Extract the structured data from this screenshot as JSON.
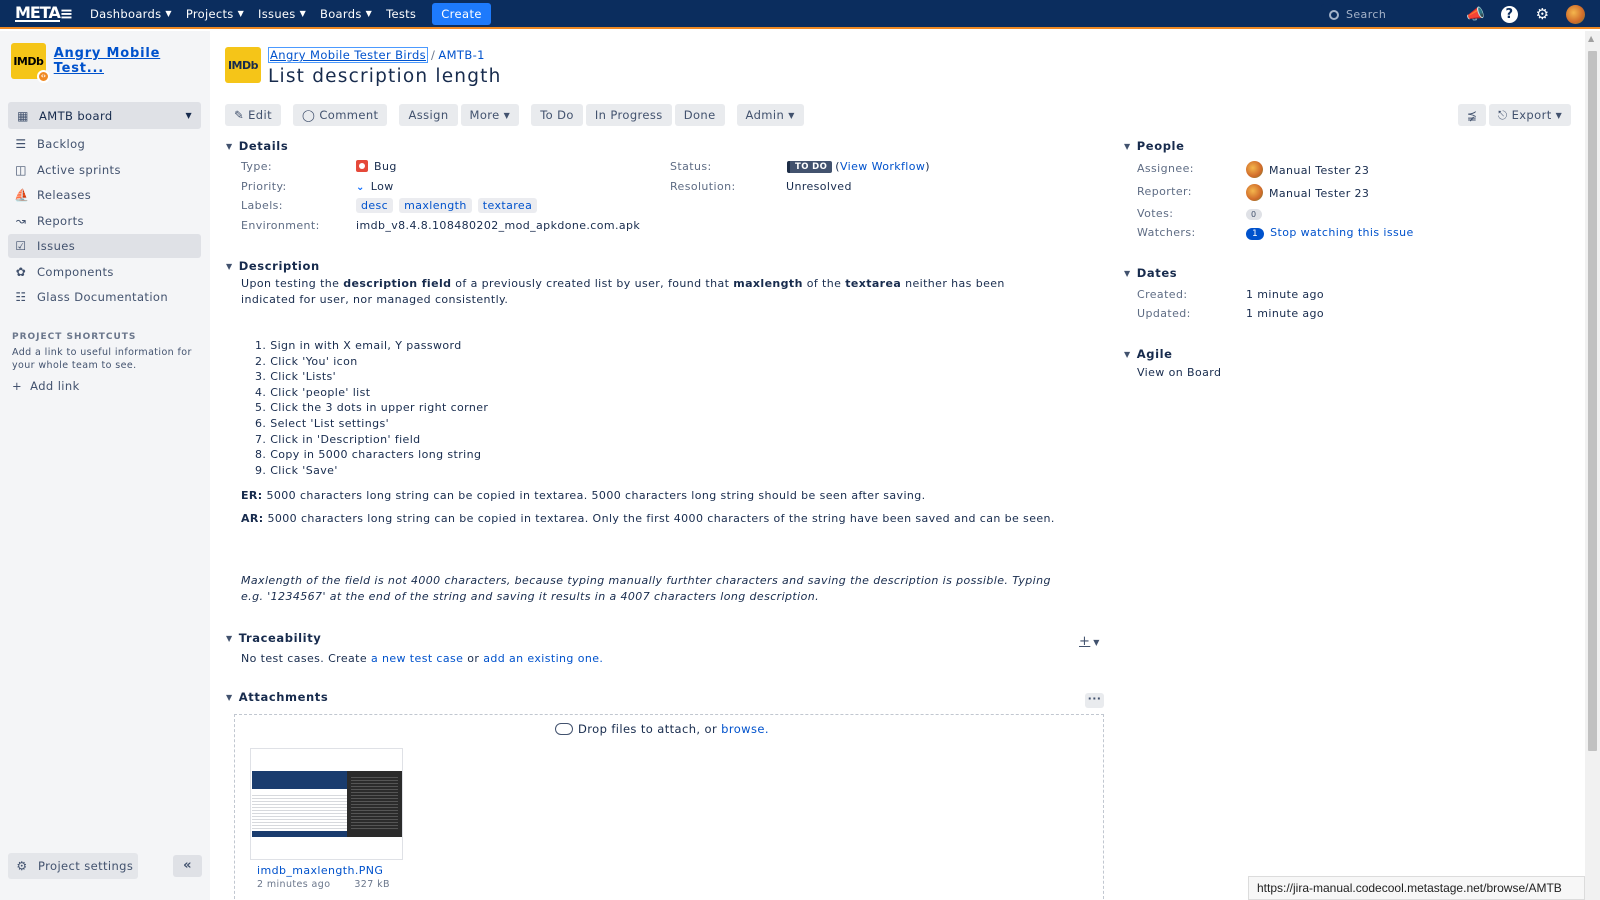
{
  "topbar": {
    "logo": "META",
    "nav": [
      "Dashboards",
      "Projects",
      "Issues",
      "Boards",
      "Tests"
    ],
    "create": "Create",
    "search_placeholder": "Search"
  },
  "sidebar": {
    "project_name": "Angry Mobile Test...",
    "project_avatar": "IMDb",
    "board": "AMTB board",
    "items": [
      {
        "label": "Backlog",
        "icon": "backlog-icon"
      },
      {
        "label": "Active sprints",
        "icon": "board-icon"
      },
      {
        "label": "Releases",
        "icon": "ship-icon"
      },
      {
        "label": "Reports",
        "icon": "chart-icon"
      },
      {
        "label": "Issues",
        "icon": "issues-icon"
      },
      {
        "label": "Components",
        "icon": "puzzle-icon"
      },
      {
        "label": "Glass Documentation",
        "icon": "glass-icon"
      }
    ],
    "shortcuts_title": "PROJECT SHORTCUTS",
    "shortcuts_desc": "Add a link to useful information for your whole team to see.",
    "add_link": "Add link",
    "project_settings": "Project settings"
  },
  "issue": {
    "breadcrumb_project": "Angry Mobile Tester Birds",
    "breadcrumb_key": "AMTB-1",
    "title": "List description length",
    "avatar": "IMDb"
  },
  "toolbar": {
    "edit": "Edit",
    "comment": "Comment",
    "assign": "Assign",
    "more": "More",
    "todo": "To Do",
    "inprogress": "In Progress",
    "done": "Done",
    "admin": "Admin",
    "export": "Export"
  },
  "details": {
    "heading": "Details",
    "type_label": "Type:",
    "type": "Bug",
    "priority_label": "Priority:",
    "priority": "Low",
    "labels_label": "Labels:",
    "labels": [
      "desc",
      "maxlength",
      "textarea"
    ],
    "environment_label": "Environment:",
    "environment": "imdb_v8.4.8.108480202_mod_apkdone.com.apk",
    "status_label": "Status:",
    "status": "TO DO",
    "view_workflow": "View Workflow",
    "resolution_label": "Resolution:",
    "resolution": "Unresolved"
  },
  "description": {
    "heading": "Description",
    "intro_1": "Upon testing the ",
    "intro_b1": "description field",
    "intro_2": " of a previously created list by user, found that ",
    "intro_b2": "maxlength",
    "intro_3": " of the ",
    "intro_b3": "textarea",
    "intro_4": " neither has been indicated for user, nor managed consistently.",
    "steps": [
      "1. Sign in with X email, Y password",
      "2. Click 'You' icon",
      "3. Click 'Lists'",
      "4. Click 'people' list",
      "5. Click the 3 dots in upper right corner",
      "6. Select 'List settings'",
      "7. Click in 'Description' field",
      "8. Copy in 5000 characters long string",
      "9. Click 'Save'"
    ],
    "er_label": "ER:",
    "er": " 5000 characters long string can be copied in textarea. 5000 characters long string should be seen after saving.",
    "ar_label": "AR:",
    "ar": " 5000 characters long string can be copied in textarea. Only the first 4000 characters of the string have been saved and can be seen.",
    "note": "Maxlength of the field is not 4000 characters, because typing manually furthter characters and saving the description is possible. Typing e.g. '1234567' at the end of the string and saving it results in a 4007 characters long description."
  },
  "traceability": {
    "heading": "Traceability",
    "text": "No test cases. Create ",
    "link1": "a new test case",
    "or": " or ",
    "link2": "add an existing one."
  },
  "attachments": {
    "heading": "Attachments",
    "drop_text": "Drop files to attach, or ",
    "browse": "browse.",
    "file_name": "imdb_maxlength.PNG",
    "file_age": "2 minutes ago",
    "file_size": "327 kB"
  },
  "people": {
    "heading": "People",
    "assignee_label": "Assignee:",
    "assignee": "Manual Tester 23",
    "reporter_label": "Reporter:",
    "reporter": "Manual Tester 23",
    "votes_label": "Votes:",
    "votes": "0",
    "watchers_label": "Watchers:",
    "watchers": "1",
    "stop_watching": "Stop watching this issue"
  },
  "dates": {
    "heading": "Dates",
    "created_label": "Created:",
    "created": "1 minute ago",
    "updated_label": "Updated:",
    "updated": "1 minute ago"
  },
  "agile": {
    "heading": "Agile",
    "view_on_board": "View on Board"
  },
  "status_bar_url": "https://jira-manual.codecool.metastage.net/browse/AMTB",
  "colors": {
    "topbar": "#0b2d5e",
    "accent": "#1d7afc",
    "link": "#0052cc",
    "bug": "#e5493a"
  }
}
